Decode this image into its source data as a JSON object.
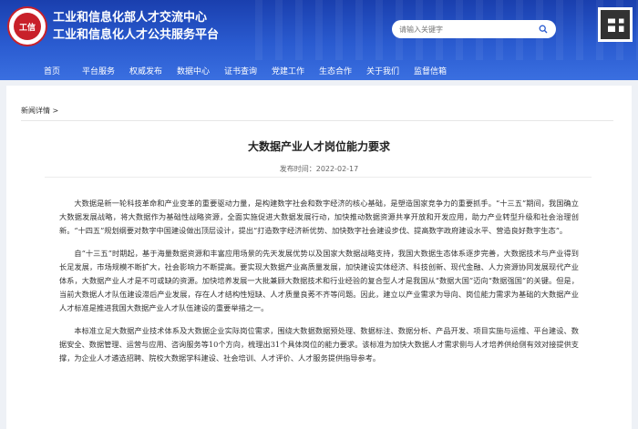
{
  "header": {
    "logo_text": "工信",
    "title_line1": "工业和信息化部人才交流中心",
    "title_line2": "工业和信息化人才公共服务平台",
    "search_placeholder": "请输入关键字"
  },
  "nav": [
    "首页",
    "平台服务",
    "权威发布",
    "数据中心",
    "证书查询",
    "党建工作",
    "生态合作",
    "关于我们",
    "监督信箱"
  ],
  "breadcrumb": "新闻详情 >",
  "article": {
    "title": "大数据产业人才岗位能力要求",
    "pubdate": "发布时间：2022-02-17",
    "paragraphs": [
      "大数据是新一轮科技革命和产业变革的重要驱动力量，是构建数字社会和数字经济的核心基础，是塑造国家竞争力的重要抓手。“十三五”期间，我国确立大数据发展战略，将大数据作为基础性战略资源，全面实施促进大数据发展行动，加快推动数据资源共享开放和开发应用，助力产业转型升级和社会治理创新。“十四五”规划纲要对数字中国建设做出顶层设计，提出“打造数字经济新优势、加快数字社会建设步伐、提高数字政府建设水平、营造良好数字生态”。",
      "自“十三五”时期起，基于海量数据资源和丰富应用场景的先天发展优势以及国家大数据战略支持，我国大数据生态体系逐步完善，大数据技术与产业得到长足发展，市场规模不断扩大，社会影响力不断提高。要实现大数据产业高质量发展，加快建设实体经济、科技创新、现代金融、人力资源协同发展现代产业体系，大数据产业人才是不可或缺的资源。加快培养发展一大批兼顾大数据技术和行业经验的复合型人才是我国从“数据大国”迈向“数据强国”的关键。但是，当前大数据人才队伍建设滞后产业发展，存在人才结构性短缺、人才质量良莠不齐等问题。因此，建立以产业需求为导向、岗位能力需求为基础的大数据产业人才标准是推进我国大数据产业人才队伍建设的重要举措之一。",
      "本标准立足大数据产业技术体系及大数据企业实际岗位需求，围绕大数据数据预处理、数据标注、数据分析、产品开发、项目实施与运维、平台建设、数据安全、数据管理、运营与应用、咨询服务等10个方向，梳理出31个具体岗位的能力要求。该标准为加快大数据人才需求侧与人才培养供给侧有效对接提供支撑，为企业人才遴选招聘、院校大数据学科建设、社会培训、人才评价、人才服务提供指导参考。"
    ]
  },
  "colors": {
    "header_blue": "#2a5bd0",
    "logo_red": "#c8202a"
  }
}
